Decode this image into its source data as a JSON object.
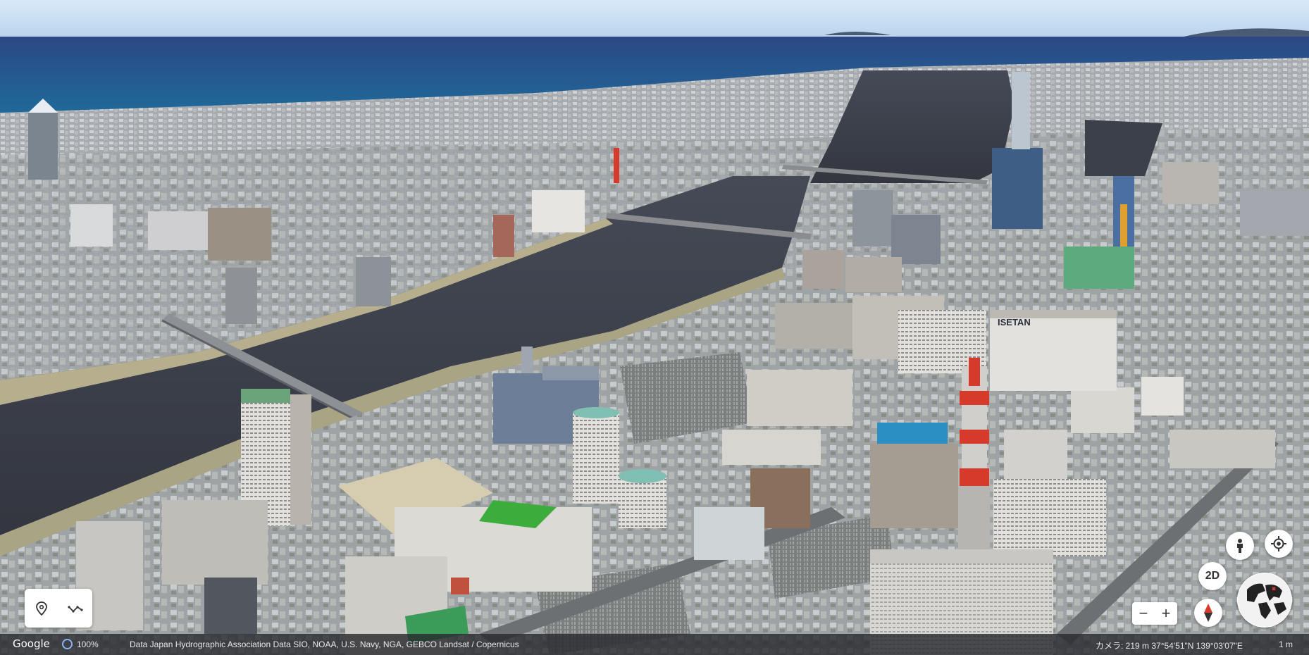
{
  "map": {
    "building_sign": "ISETAN"
  },
  "controls": {
    "layers_icons": [
      "location-pin-icon",
      "path-icon"
    ],
    "pegman_icon": "pegman-icon",
    "my_location_icon": "my-location-icon",
    "view_mode_label": "2D",
    "zoom_out_label": "−",
    "zoom_in_label": "+",
    "compass_icon": "compass-icon",
    "globe_icon": "globe-icon"
  },
  "footer": {
    "logo": "Google",
    "zoom_percent": "100%",
    "attribution": "Data Japan Hydrographic Association   Data SIO, NOAA, U.S. Navy, NGA, GEBCO   Landsat / Copernicus",
    "camera": "カメラ: 219 m    37°54'51\"N 139°03'07\"E",
    "scale": "1 m"
  },
  "colors": {
    "sky": "#cfe1f2",
    "sea": "#2f4a86",
    "river": "#3b3f4a",
    "accent_red": "#d63a2a",
    "footer_bg": "#2a2c2e"
  }
}
